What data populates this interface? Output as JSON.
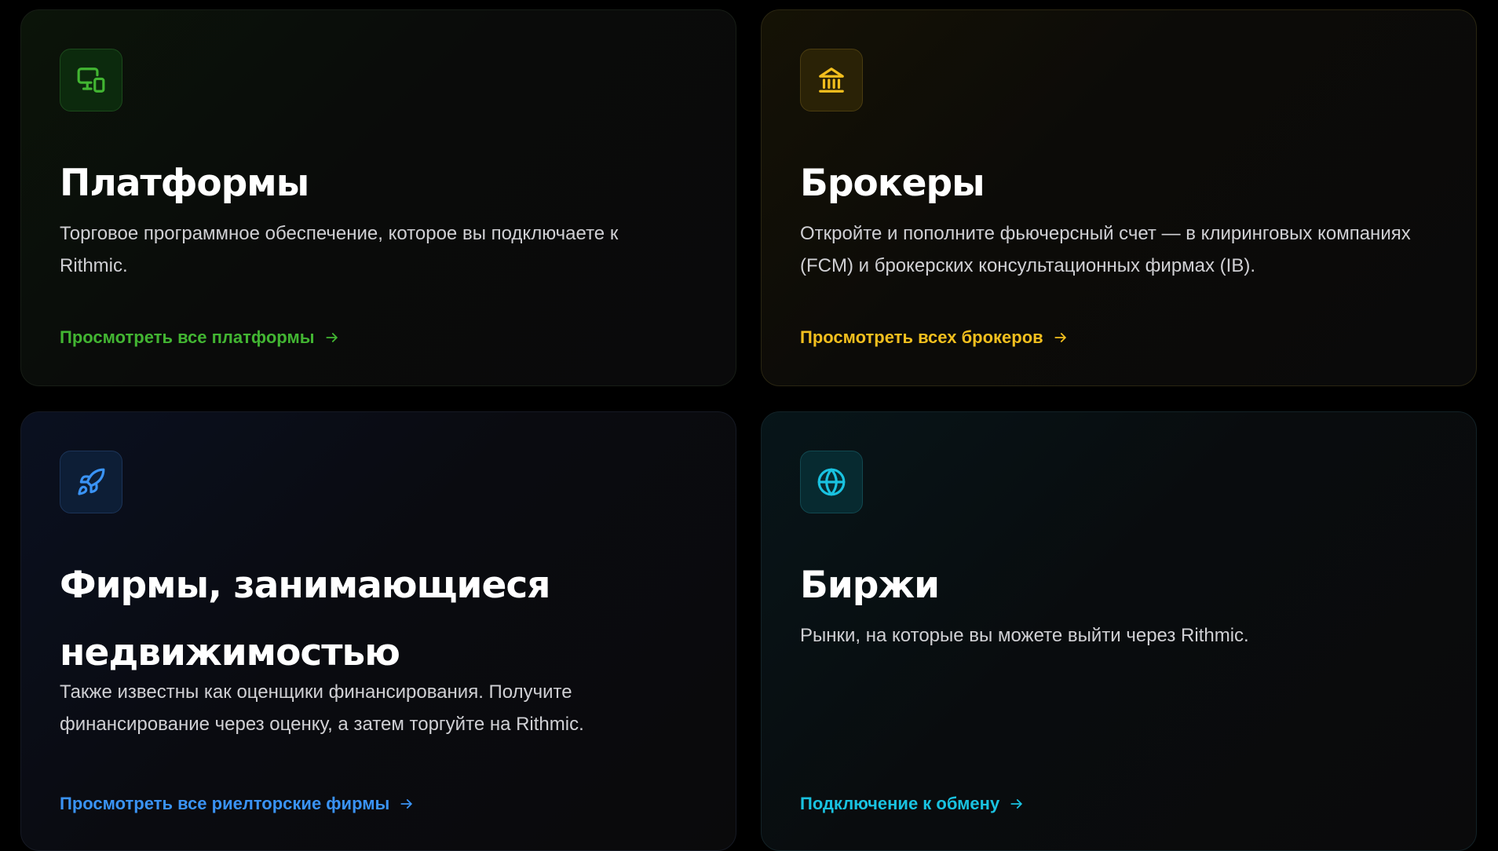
{
  "cards": {
    "platforms": {
      "icon": "monitor-devices-icon",
      "title": "Платформы",
      "description": "Торговое программное обеспечение, которое вы подключаете к Rithmic.",
      "link": "Просмотреть все платформы",
      "accent": "#42b532"
    },
    "brokers": {
      "icon": "bank-icon",
      "title": "Брокеры",
      "description": "Откройте и пополните фьючерсный счет — в клиринговых компаниях (FCM) и брокерских консультационных фирмах (IB).",
      "link": "Просмотреть всех брокеров",
      "accent": "#f2bf1e"
    },
    "firms": {
      "icon": "rocket-icon",
      "title": "Фирмы, занимающиеся недвижимостью",
      "description": "Также известны как оценщики финансирования. Получите финансирование через оценку, а затем торгуйте на Rithmic.",
      "link": "Просмотреть все риелторские фирмы",
      "accent": "#3a93f5"
    },
    "exchanges": {
      "icon": "globe-icon",
      "title": "Биржи",
      "description": "Рынки, на которые вы можете выйти через Rithmic.",
      "link": "Подключение к обмену",
      "accent": "#19c2e0"
    }
  }
}
